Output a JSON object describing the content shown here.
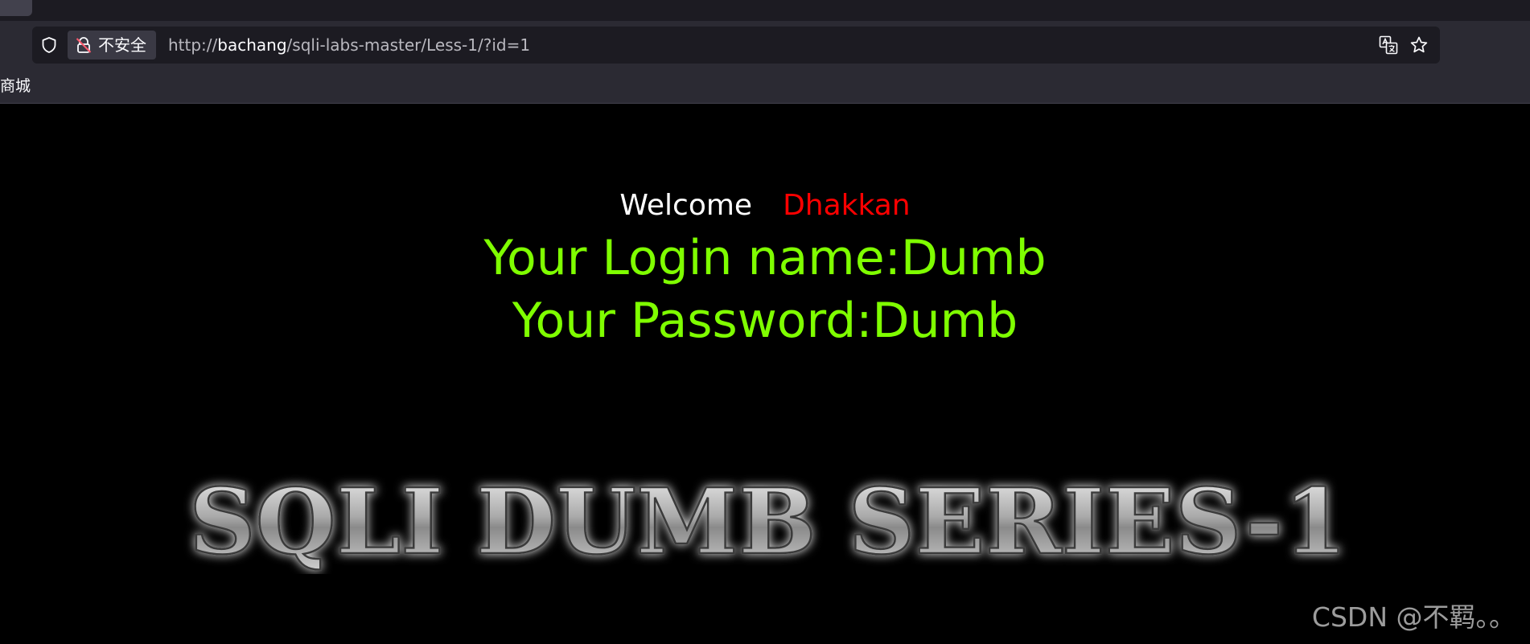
{
  "browser": {
    "security_label": "不安全",
    "url": {
      "scheme": "http://",
      "host": "bachang",
      "path": "/sqli-labs-master/Less-1/?id=1"
    },
    "bookmark_label": "商城"
  },
  "page": {
    "welcome_text": "Welcome",
    "welcome_name": "Dhakkan",
    "login_line": "Your Login name:Dumb",
    "password_line": "Your Password:Dumb",
    "banner_text": "SQLI DUMB SERIES-1"
  },
  "watermark": "CSDN @不羁。。",
  "colors": {
    "chrome_bg": "#2b2a33",
    "url_bar_bg": "#1c1b22",
    "page_bg": "#000000",
    "welcome": "#ffffff",
    "name": "#ff0000",
    "credentials": "#7fff00"
  },
  "icons": [
    "shield-icon",
    "lock-warning-icon",
    "translate-icon",
    "star-icon"
  ]
}
